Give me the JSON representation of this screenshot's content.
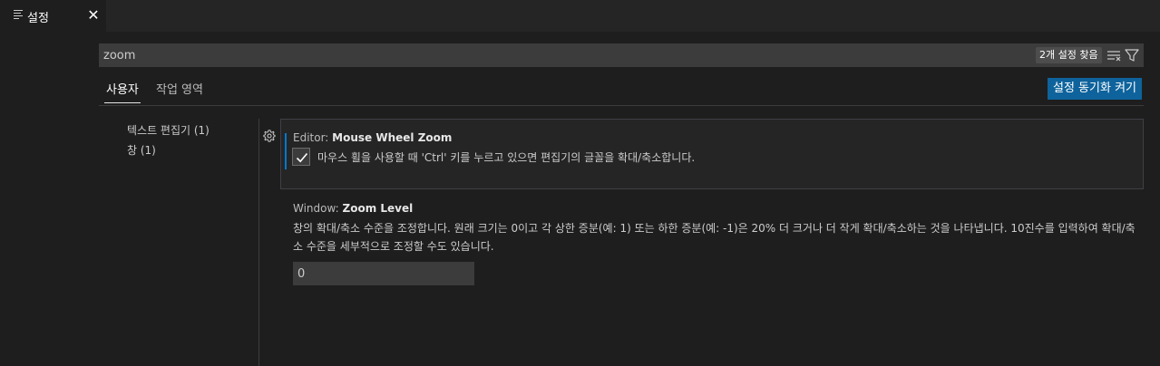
{
  "tab": {
    "label": "설정",
    "close_symbol": "✕"
  },
  "search": {
    "value": "zoom",
    "result_count": "2개 설정 찾음"
  },
  "scopes": {
    "user": "사용자",
    "workspace": "작업 영역"
  },
  "sync_button": "설정 동기화 켜기",
  "toc": [
    "텍스트 편집기 (1)",
    "창 (1)"
  ],
  "settings": [
    {
      "category": "Editor: ",
      "name": "Mouse Wheel Zoom",
      "checked": true,
      "description": "마우스 휠을 사용할 때 'Ctrl' 키를 누르고 있으면 편집기의 글꼴을 확대/축소합니다."
    },
    {
      "category": "Window: ",
      "name": "Zoom Level",
      "description": "창의 확대/축소 수준을 조정합니다. 원래 크기는 0이고 각 상한 증분(예: 1) 또는 하한 증분(예: -1)은 20% 더 크거나 더 작게 확대/축소하는 것을 나타냅니다. 10진수를 입력하여 확대/축소 수준을 세부적으로 조정할 수도 있습니다.",
      "value": "0"
    }
  ],
  "colors": {
    "accent": "#007acc",
    "button": "#0e639c",
    "background": "#1e1e1e"
  }
}
